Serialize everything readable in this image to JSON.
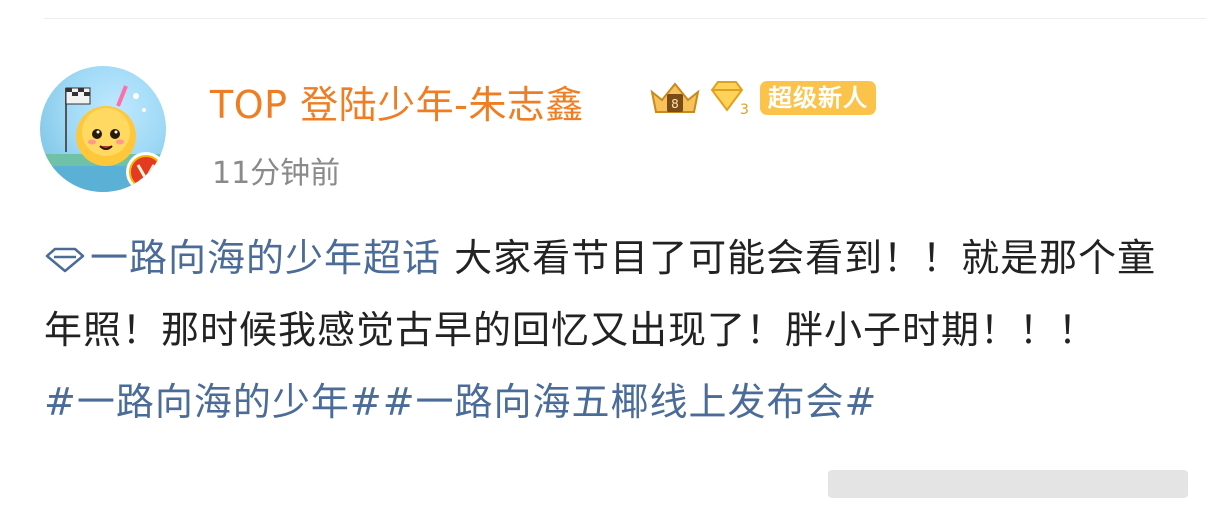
{
  "post": {
    "username": "TOP 登陆少年-朱志鑫",
    "badge_label": "超级新人",
    "timestamp": "11分钟前",
    "supertopic_link": "一路向海的少年超话",
    "body_text": " 大家看节目了可能会看到！！就是那个童年照！那时候我感觉古早的回忆又出现了！胖小子时期！！！",
    "hashtags": [
      "#一路向海的少年#",
      "#一路向海五椰线上发布会#"
    ]
  },
  "colors": {
    "username": "#f07d22",
    "link": "#4b6b98",
    "timestamp": "#8a8a8a",
    "badge_bg": "#fbc34a",
    "verified_red": "#e23b21"
  },
  "icons": [
    "crown-level-icon",
    "diamond-vip-icon",
    "verified-v-icon",
    "supertopic-diamond-icon"
  ]
}
